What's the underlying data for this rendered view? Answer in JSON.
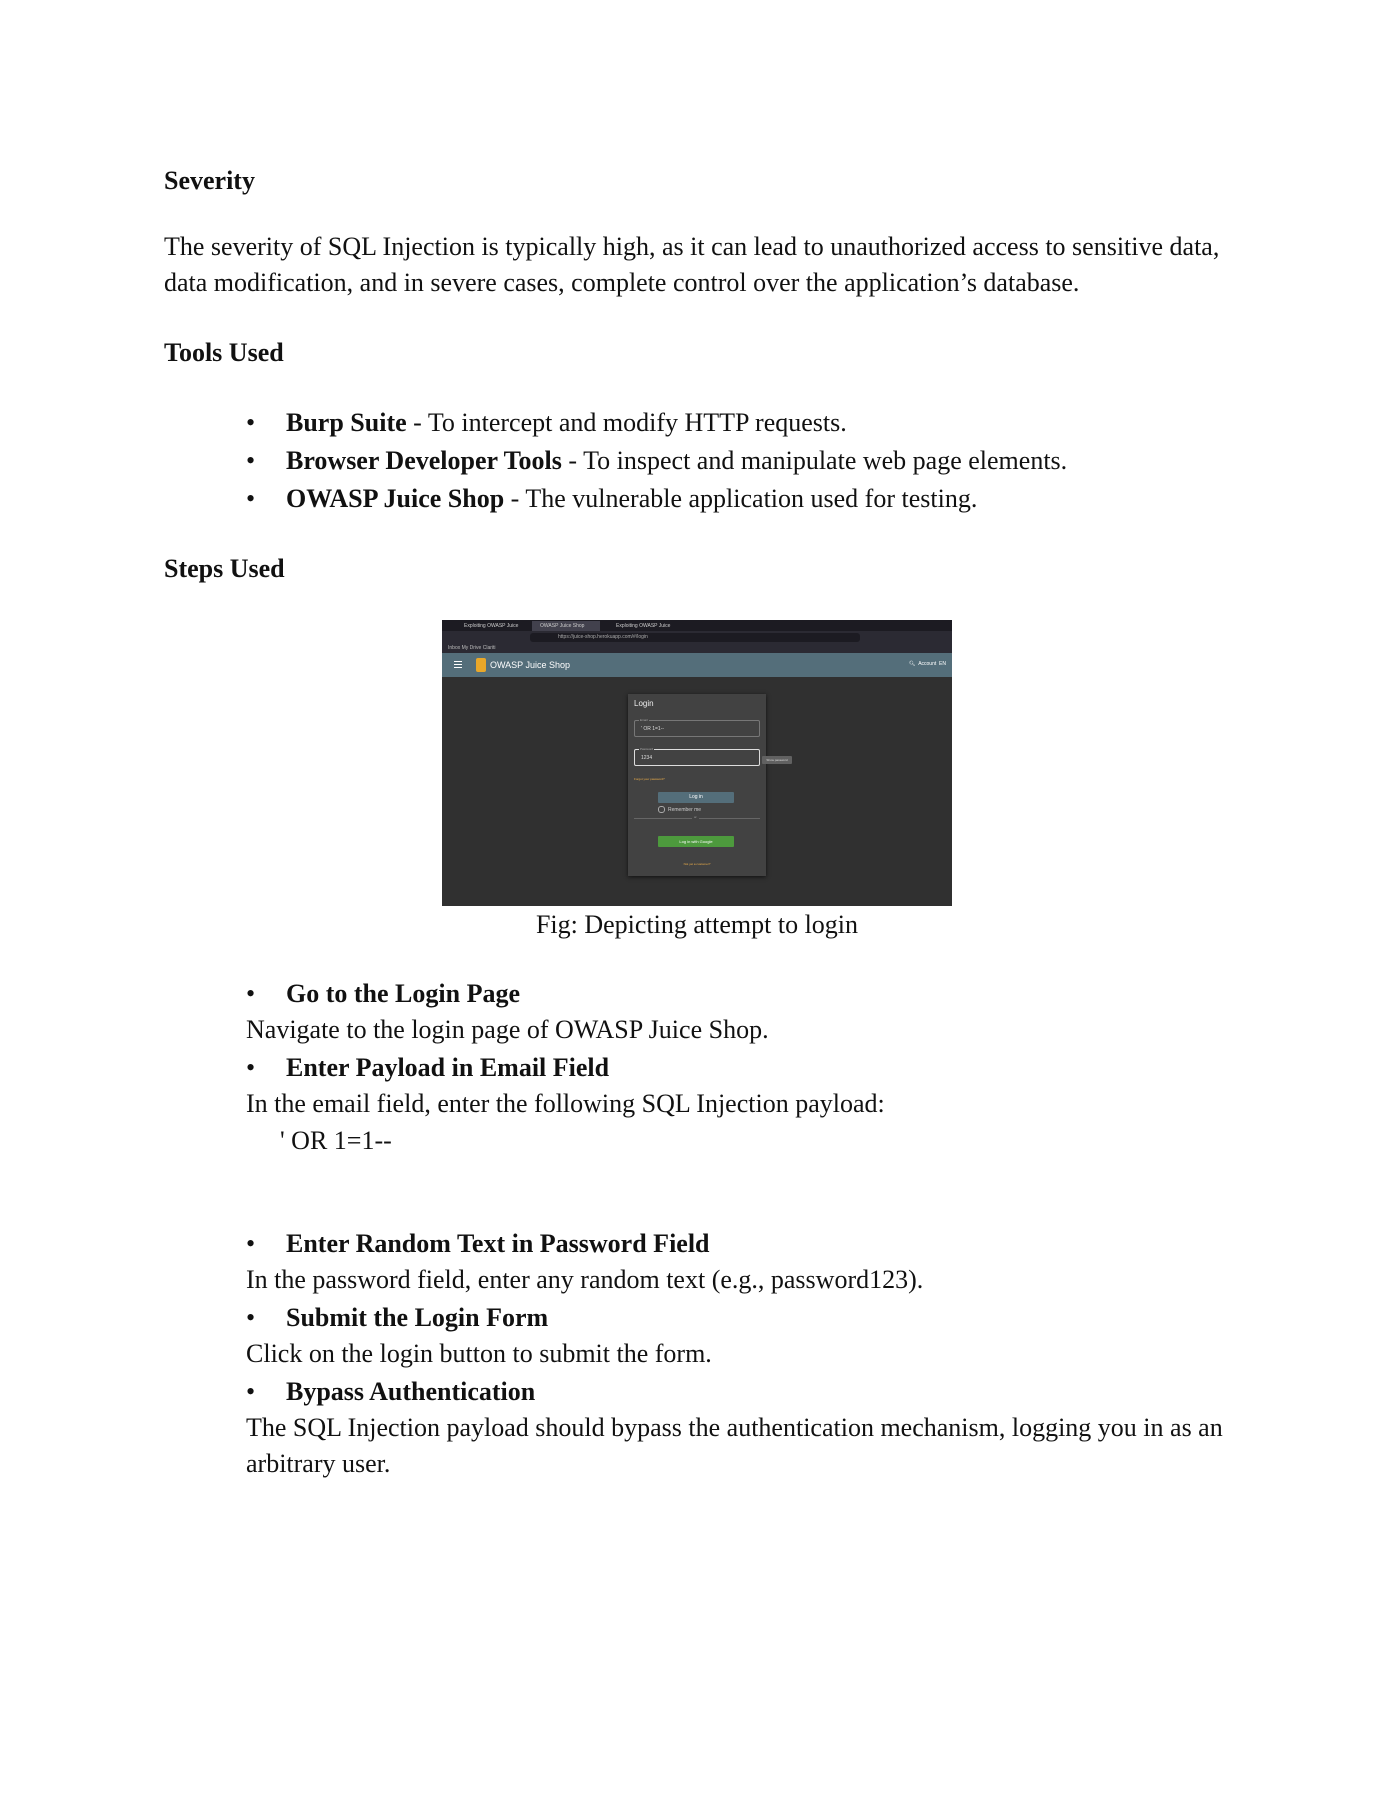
{
  "severity": {
    "heading": "Severity",
    "text": "The severity of SQL Injection is typically high, as it can lead to unauthorized access to sensitive data, data modification, and in severe cases, complete control over the application’s database."
  },
  "tools": {
    "heading": "Tools Used",
    "items": [
      {
        "name": "Burp Suite",
        "desc": " - To intercept and modify HTTP requests."
      },
      {
        "name": "Browser Developer Tools",
        "desc": " - To inspect and manipulate web page elements."
      },
      {
        "name": "OWASP Juice Shop",
        "desc": " - The vulnerable application used for testing."
      }
    ]
  },
  "steps": {
    "heading": "Steps Used",
    "figure": {
      "caption": "Fig: Depicting attempt to login",
      "tabs": [
        "Exploiting OWASP Juice",
        "OWASP Juice Shop",
        "Exploiting OWASP Juice"
      ],
      "url": "https://juice-shop.herokuapp.com/#/login",
      "bookmarks": "Inbox   My Drive   Clariti",
      "app_title": "OWASP Juice Shop",
      "account_label": "Account",
      "language_label": "EN",
      "login_title": "Login",
      "email_label": "Email",
      "email_value": "' OR 1=1--",
      "password_label": "Password",
      "password_value": "1234",
      "tooltip": "Show password",
      "forgot": "Forgot your password?",
      "login_button": "Log in",
      "remember": "Remember me",
      "or": "or",
      "google_button": "Log in with Google",
      "not_customer": "Not yet a customer?"
    },
    "items": [
      {
        "title": "Go to the Login Page",
        "desc": "Navigate to the login page of OWASP Juice Shop."
      },
      {
        "title": "Enter Payload in Email Field",
        "desc": "In the email field, enter the following SQL Injection payload:"
      },
      {
        "title": "Enter Random Text in Password Field",
        "desc": "In the password field, enter any random text (e.g., password123)."
      },
      {
        "title": "Submit the Login Form",
        "desc": "Click on the login button to submit the form."
      },
      {
        "title": "Bypass Authentication",
        "desc": "The SQL Injection payload should bypass the authentication mechanism, logging you in as an arbitrary user."
      }
    ],
    "payload": "' OR 1=1--"
  }
}
